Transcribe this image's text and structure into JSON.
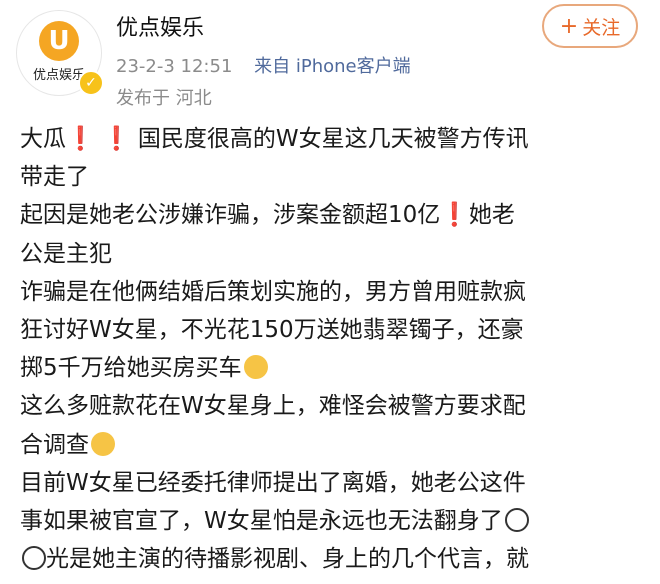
{
  "post": {
    "user": {
      "name": "优点娱乐",
      "avatar_text": "优点娱乐",
      "avatar_mark": "U"
    },
    "follow_label": "关注",
    "follow_plus": "+",
    "timestamp": "23-2-3 12:51",
    "source": "来自 iPhone客户端",
    "location": "发布于 河北",
    "content": {
      "lines": [
        {
          "pre": "大瓜",
          "b1": "❗",
          "b2": "❗",
          "text": "国民度很高的W女星这几天被警方传讯"
        },
        {
          "text": "带走了"
        },
        {
          "text": "起因是她老公涉嫌诈骗，涉案金额超10亿",
          "bang": "❗",
          "post": "她老"
        },
        {
          "text": "公是主犯"
        },
        {
          "text": "诈骗是在他俩结婚后策划实施的，男方曾用赃款疯"
        },
        {
          "text": "狂讨好W女星，不光花150万送她翡翠镯子，还豪"
        },
        {
          "text": "掷5千万给她买房买车"
        },
        {
          "text": "这么多赃款花在W女星身上，难怪会被警方要求配"
        },
        {
          "text": "合调查"
        },
        {
          "text": "目前W女星已经委托律师提出了离婚，她老公这件"
        },
        {
          "text": "事如果被官宣了，W女星怕是永远也无法翻身了"
        },
        {
          "text": "光是她主演的待播影视剧、身上的几个代言，就"
        }
      ]
    }
  },
  "colors": {
    "accent_orange": "#e8692a",
    "follow_border": "#e8a87c",
    "meta_gray": "#8b8b8b",
    "source_blue": "#506a9c",
    "exclamation_red": "#e0301e"
  },
  "icons": {
    "avatar_logo": "orange-u-logo",
    "verified": "yellow-verified-badge",
    "emoji_1": "yellow-smirk-emoji",
    "emoji_2": "yellow-wink-emoji",
    "emoji_3": "panda-face-emoji",
    "emoji_4": "panda-face-emoji"
  }
}
